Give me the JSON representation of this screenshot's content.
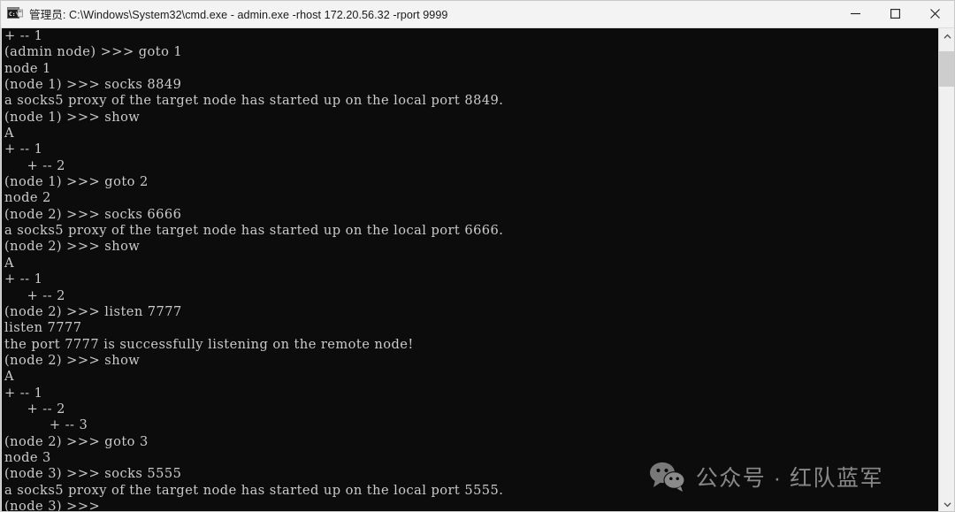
{
  "window": {
    "title": "管理员: C:\\Windows\\System32\\cmd.exe - admin.exe  -rhost 172.20.56.32 -rport 9999",
    "app_icon": "cmd-console-icon",
    "minimize_label": "─",
    "maximize_label": "□",
    "close_label": "✕",
    "background": "#0c0c0c",
    "titlebar_background": "#f3f3f3",
    "text_color": "#cccccc"
  },
  "scrollbar": {
    "up_arrow": "⌃",
    "down_arrow": "⌄",
    "thumb_color": "#cdcdcd",
    "track_color": "#f0f0f0"
  },
  "watermark": {
    "icon": "wechat-icon",
    "text": "公众号 · 红队蓝军"
  },
  "console": {
    "prompt_symbol": ">>>",
    "lines": [
      "+ -- 1",
      "(admin node) >>> goto 1",
      "node 1",
      "(node 1) >>> socks 8849",
      "a socks5 proxy of the target node has started up on the local port 8849.",
      "(node 1) >>> show",
      "A",
      "+ -- 1",
      "     + -- 2",
      "(node 1) >>> goto 2",
      "node 2",
      "(node 2) >>> socks 6666",
      "a socks5 proxy of the target node has started up on the local port 6666.",
      "(node 2) >>> show",
      "A",
      "+ -- 1",
      "     + -- 2",
      "(node 2) >>> listen 7777",
      "listen 7777",
      "the port 7777 is successfully listening on the remote node!",
      "(node 2) >>> show",
      "A",
      "+ -- 1",
      "     + -- 2",
      "          + -- 3",
      "(node 2) >>> goto 3",
      "node 3",
      "(node 3) >>> socks 5555",
      "a socks5 proxy of the target node has started up on the local port 5555.",
      "(node 3) >>> "
    ]
  }
}
